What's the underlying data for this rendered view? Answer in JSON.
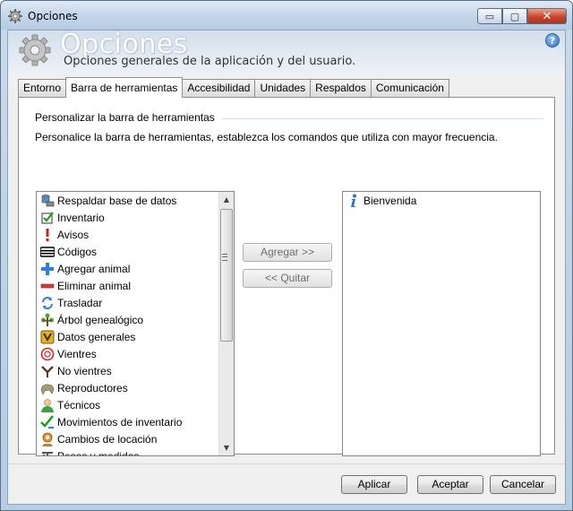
{
  "window": {
    "title": "Opciones",
    "controls": {
      "minimize": "▭",
      "maximize": "▢",
      "close": "✕"
    }
  },
  "header": {
    "title": "Opciones",
    "subtitle": "Opciones generales de la aplicación y del usuario.",
    "help": "?"
  },
  "tabs": [
    {
      "label": "Entorno"
    },
    {
      "label": "Barra de herramientas",
      "active": true
    },
    {
      "label": "Accesibilidad"
    },
    {
      "label": "Unidades"
    },
    {
      "label": "Respaldos"
    },
    {
      "label": "Comunicación"
    }
  ],
  "panel": {
    "group_label": "Personalizar la barra de herramientas",
    "description": "Personalice la barra de herramientas, establezca los comandos que utiliza con mayor frecuencia.",
    "available": [
      {
        "label": "Respaldar base de datos",
        "icon": "database-backup-icon"
      },
      {
        "label": "Inventario",
        "icon": "checklist-icon"
      },
      {
        "label": "Avisos",
        "icon": "exclamation-icon"
      },
      {
        "label": "Códigos",
        "icon": "barcode-icon"
      },
      {
        "label": "Agregar animal",
        "icon": "plus-icon"
      },
      {
        "label": "Eliminar animal",
        "icon": "minus-icon"
      },
      {
        "label": "Trasladar",
        "icon": "transfer-arrows-icon"
      },
      {
        "label": "Árbol genealógico",
        "icon": "family-tree-icon"
      },
      {
        "label": "Datos generales",
        "icon": "data-card-icon"
      },
      {
        "label": "Vientres",
        "icon": "female-icon"
      },
      {
        "label": "No vientres",
        "icon": "no-female-icon"
      },
      {
        "label": "Reproductores",
        "icon": "bull-icon"
      },
      {
        "label": "Técnicos",
        "icon": "person-icon"
      },
      {
        "label": "Movimientos de inventario",
        "icon": "inventory-moves-icon"
      },
      {
        "label": "Cambios de locación",
        "icon": "location-icon"
      },
      {
        "label": "Pesos y medidas",
        "icon": "scale-icon"
      }
    ],
    "selected": [
      {
        "label": "Bienvenida",
        "icon": "info-icon"
      }
    ],
    "add_button": "Agregar >>",
    "remove_button": "<< Quitar"
  },
  "footer": {
    "apply": "Aplicar",
    "accept": "Aceptar",
    "cancel": "Cancelar"
  },
  "colors": {
    "accent": "#2e6fc4",
    "close_button": "#c6462a",
    "title_text": "#ffffff"
  }
}
